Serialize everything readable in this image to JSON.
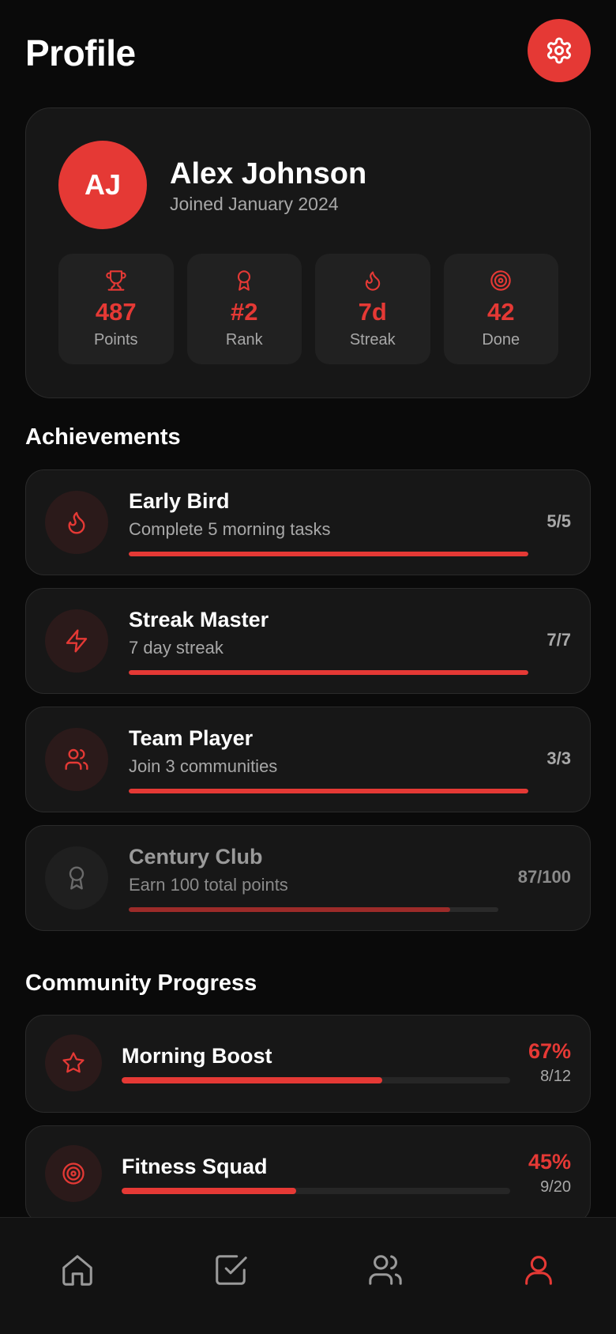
{
  "header": {
    "title": "Profile",
    "settings_icon": "gear-icon"
  },
  "profile": {
    "initials": "AJ",
    "name": "Alex Johnson",
    "joined": "Joined January 2024",
    "stats": [
      {
        "icon": "trophy-icon",
        "value": "487",
        "label": "Points"
      },
      {
        "icon": "award-icon",
        "value": "#2",
        "label": "Rank"
      },
      {
        "icon": "flame-icon",
        "value": "7d",
        "label": "Streak"
      },
      {
        "icon": "target-icon",
        "value": "42",
        "label": "Done"
      }
    ]
  },
  "achievements": {
    "title": "Achievements",
    "items": [
      {
        "icon": "flame-icon",
        "title": "Early Bird",
        "desc": "Complete 5 morning tasks",
        "count": "5/5",
        "progress": 1.0,
        "locked": false
      },
      {
        "icon": "lightning-icon",
        "title": "Streak Master",
        "desc": "7 day streak",
        "count": "7/7",
        "progress": 1.0,
        "locked": false
      },
      {
        "icon": "users-icon",
        "title": "Team Player",
        "desc": "Join 3 communities",
        "count": "3/3",
        "progress": 1.0,
        "locked": false
      },
      {
        "icon": "award-icon",
        "title": "Century Club",
        "desc": "Earn 100 total points",
        "count": "87/100",
        "progress": 0.87,
        "locked": true
      }
    ]
  },
  "community": {
    "title": "Community Progress",
    "items": [
      {
        "icon": "star-icon",
        "name": "Morning Boost",
        "percent": "67%",
        "count": "8/12",
        "progress": 0.67
      },
      {
        "icon": "target-icon",
        "name": "Fitness Squad",
        "percent": "45%",
        "count": "9/20",
        "progress": 0.45
      }
    ]
  },
  "nav": {
    "items": [
      {
        "icon": "home-icon",
        "active": false
      },
      {
        "icon": "tasks-icon",
        "active": false
      },
      {
        "icon": "community-icon",
        "active": false
      },
      {
        "icon": "profile-icon",
        "active": true
      }
    ]
  },
  "colors": {
    "accent": "#e53935",
    "background": "#0a0a0a",
    "card": "#171717",
    "muted": "#a8a8a8"
  }
}
